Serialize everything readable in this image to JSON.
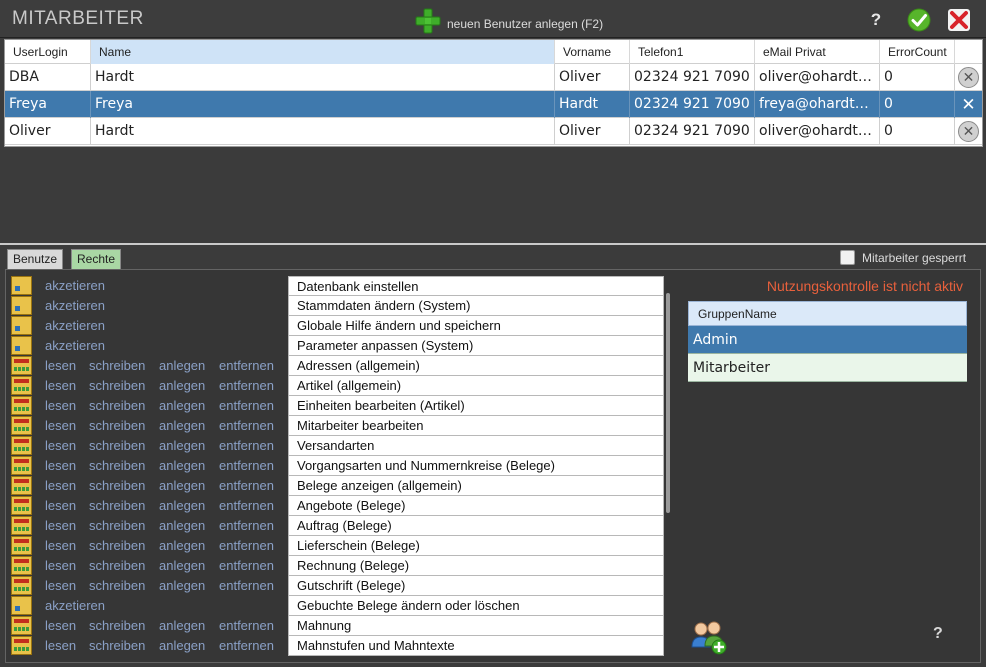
{
  "header": {
    "title": "MITARBEITER",
    "new_user_label": "neuen Benutzer anlegen (F2)",
    "help_label": "?"
  },
  "users": {
    "columns": [
      "UserLogin",
      "Name",
      "Vorname",
      "Telefon1",
      "eMail Privat",
      "ErrorCount"
    ],
    "rows": [
      {
        "login": "DBA",
        "name": "Hardt",
        "vorname": "Oliver",
        "telefon": "02324 921 7090",
        "email": "oliver@ohardt…",
        "errors": "0"
      },
      {
        "login": "Freya",
        "name": "Freya",
        "vorname": "Hardt",
        "telefon": "02324 921 7090",
        "email": "freya@ohardt…",
        "errors": "0"
      },
      {
        "login": "Oliver",
        "name": "Hardt",
        "vorname": "Oliver",
        "telefon": "02324 921 7090",
        "email": "oliver@ohardt…",
        "errors": "0"
      }
    ],
    "selected_row": 1
  },
  "tabs": {
    "benutzer": "Benutze",
    "rechte": "Rechte"
  },
  "locked_label": "Mitarbeiter gesperrt",
  "rights_actions": {
    "akzeptieren": "akzetieren",
    "lesen": "lesen",
    "schreiben": "schreiben",
    "anlegen": "anlegen",
    "entfernen": "entfernen"
  },
  "rights": [
    {
      "type": "ja",
      "name": "Datenbank einstellen"
    },
    {
      "type": "ja",
      "name": "Stammdaten ändern (System)"
    },
    {
      "type": "ja",
      "name": "Globale Hilfe ändern und speichern"
    },
    {
      "type": "ja",
      "name": "Parameter anpassen (System)"
    },
    {
      "type": "lsae",
      "name": "Adressen (allgemein)"
    },
    {
      "type": "lsae",
      "name": "Artikel (allgemein)"
    },
    {
      "type": "lsae",
      "name": "Einheiten bearbeiten (Artikel)"
    },
    {
      "type": "lsae",
      "name": "Mitarbeiter bearbeiten"
    },
    {
      "type": "lsae",
      "name": "Versandarten"
    },
    {
      "type": "lsae",
      "name": "Vorgangsarten und Nummernkreise (Belege)"
    },
    {
      "type": "lsae",
      "name": "Belege anzeigen (allgemein)"
    },
    {
      "type": "lsae",
      "name": "Angebote (Belege)"
    },
    {
      "type": "lsae",
      "name": "Auftrag (Belege)"
    },
    {
      "type": "lsae",
      "name": "Lieferschein (Belege)"
    },
    {
      "type": "lsae",
      "name": "Rechnung (Belege)"
    },
    {
      "type": "lsae",
      "name": "Gutschrift (Belege)"
    },
    {
      "type": "ja",
      "name": "Gebuchte Belege ändern oder löschen"
    },
    {
      "type": "lsae",
      "name": "Mahnung"
    },
    {
      "type": "lsae",
      "name": "Mahnstufen und Mahntexte"
    }
  ],
  "nutzungskontrolle": "Nutzungskontrolle ist nicht aktiv",
  "groups": {
    "header": "GruppenName",
    "items": [
      "Admin",
      "Mitarbeiter"
    ],
    "selected": 0
  },
  "colors": {
    "selected_row": "#3f79ad",
    "warning": "#e8603c",
    "rechte_tab": "#a9d7a4",
    "link": "#8aa0c6"
  }
}
